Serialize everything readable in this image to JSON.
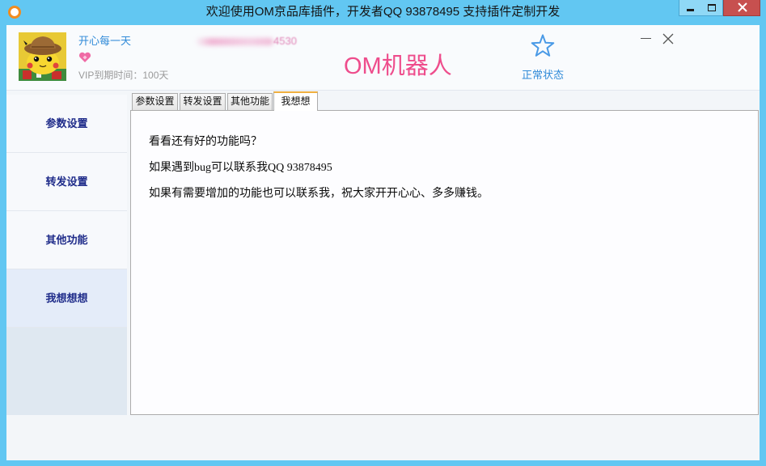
{
  "window": {
    "title": "欢迎使用OM京品库插件，开发者QQ 93878495 支持插件定制开发",
    "app_icon": "orange-ring-icon",
    "controls": [
      "minimize-icon",
      "maximize-icon",
      "close-icon"
    ]
  },
  "header": {
    "avatar": "pikachu-detective-avatar",
    "username": "开心每一天",
    "vip_icon": "pink-heart-icon",
    "vip_expiry": "VIP到期时间：100天",
    "account_id_visible_tail": "4530",
    "app_name": "OM机器人",
    "status": {
      "icon": "star-outline-icon",
      "label": "正常状态"
    },
    "panel_controls": [
      "minimize-icon",
      "close-icon"
    ]
  },
  "sidebar": {
    "items": [
      {
        "label": "参数设置",
        "active": false
      },
      {
        "label": "转发设置",
        "active": false
      },
      {
        "label": "其他功能",
        "active": false
      },
      {
        "label": "我想想想",
        "active": true
      }
    ]
  },
  "tabs": [
    {
      "label": "参数设置",
      "active": false
    },
    {
      "label": "转发设置",
      "active": false
    },
    {
      "label": "其他功能",
      "active": false
    },
    {
      "label": "我想想",
      "active": true
    }
  ],
  "content": {
    "lines": [
      "看看还有好的功能吗？",
      "如果遇到bug可以联系我QQ 93878495",
      "如果有需要增加的功能也可以联系我，祝大家开开心心、多多赚钱。"
    ]
  },
  "colors": {
    "title_bar": "#62c7f2",
    "close_button": "#c7504f",
    "app_icon": "#f28c1e",
    "accent_pink": "#ee4d8c",
    "link_blue": "#2f8ad8",
    "sidebar_text": "#1f2c8a",
    "tab_highlight": "#f0b040"
  }
}
